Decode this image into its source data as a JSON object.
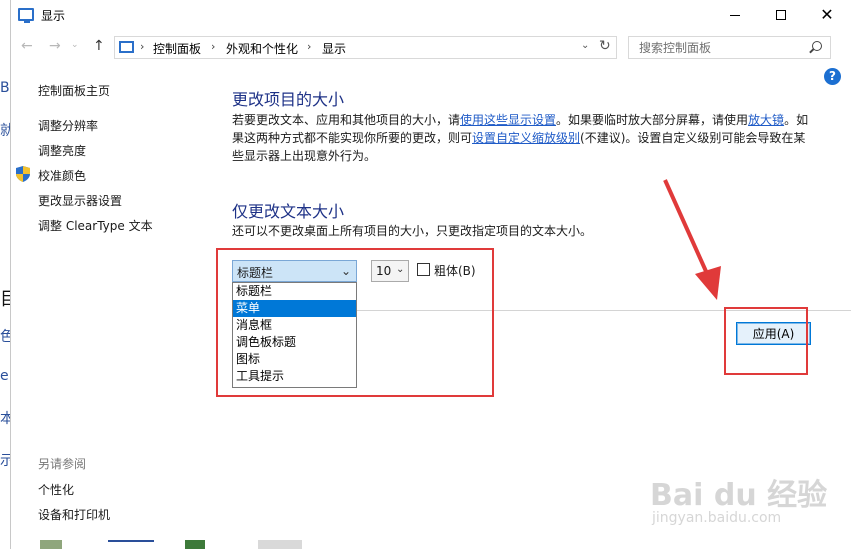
{
  "window": {
    "title": "显示",
    "controls": {
      "minimize": "—",
      "maximize": "☐",
      "close": "✕"
    }
  },
  "address": {
    "crumbs": [
      "控制面板",
      "外观和个性化",
      "显示"
    ],
    "separator": "›"
  },
  "search": {
    "placeholder": "搜索控制面板"
  },
  "help": {
    "label": "?"
  },
  "sidebar": {
    "home": "控制面板主页",
    "items": [
      "调整分辨率",
      "调整亮度",
      "校准颜色",
      "更改显示器设置",
      "调整 ClearType 文本"
    ],
    "see_also_title": "另请参阅",
    "see_also": [
      "个性化",
      "设备和打印机"
    ]
  },
  "main": {
    "section1": {
      "heading": "更改项目的大小",
      "line1_a": "若要更改文本、应用和其他项目的大小，请",
      "line1_link": "使用这些显示设置",
      "line1_b": "。如果要临时放大部分屏幕，请使用",
      "line1_link2": "放大镜",
      "line1_c": "。如",
      "line2_a": "果这两种方式都不能实现你所要的更改，则可",
      "line2_link": "设置自定义缩放级别",
      "line2_b": "(不建议)。设置自定义级别可能会导致在某",
      "line3": "些显示器上出现意外行为。"
    },
    "section2": {
      "heading": "仅更改文本大小",
      "desc": "还可以不更改桌面上所有项目的大小，只更改指定项目的文本大小。",
      "item_select_value": "标题栏",
      "size_select_value": "10",
      "bold_label": "粗体(B)",
      "bold_checked": false,
      "dropdown_options": [
        "标题栏",
        "菜单",
        "消息框",
        "调色板标题",
        "图标",
        "工具提示"
      ],
      "highlighted_option": "菜单"
    },
    "apply_label": "应用(A)"
  },
  "watermark": {
    "text": "Bai du 经验",
    "sub": "jingyan.baidu.com"
  },
  "colors": {
    "heading": "#1e3287",
    "link": "#1f5bc7",
    "annotation": "#e03a3a",
    "selection": "#0078d7"
  }
}
